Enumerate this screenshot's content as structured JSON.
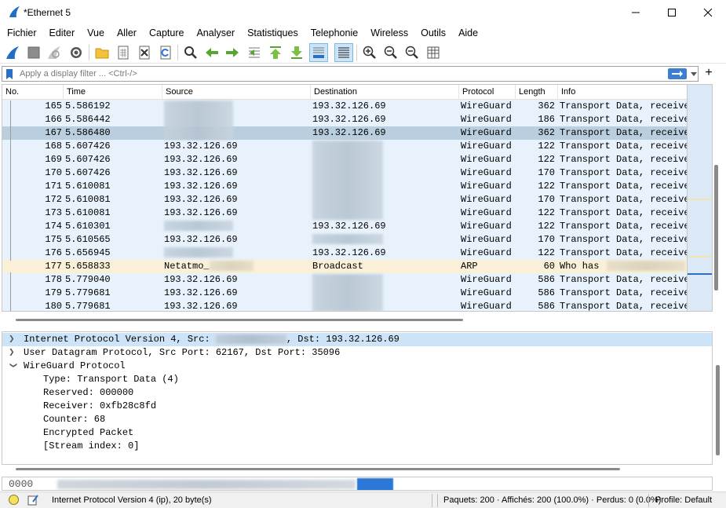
{
  "window": {
    "title": "*Ethernet 5"
  },
  "menu": [
    "Fichier",
    "Editer",
    "Vue",
    "Aller",
    "Capture",
    "Analyser",
    "Statistiques",
    "Telephonie",
    "Wireless",
    "Outils",
    "Aide"
  ],
  "filter": {
    "placeholder": "Apply a display filter ... <Ctrl-/>",
    "plus": "+"
  },
  "packet_list": {
    "columns": [
      "No.",
      "Time",
      "Source",
      "Destination",
      "Protocol",
      "Length",
      "Info"
    ],
    "rows": [
      {
        "no": "165",
        "time": "5.586192",
        "src": "",
        "dst": "193.32.126.69",
        "proto": "WireGuard",
        "len": "362",
        "info": "Transport Data, receive"
      },
      {
        "no": "166",
        "time": "5.586442",
        "src": "",
        "dst": "193.32.126.69",
        "proto": "WireGuard",
        "len": "186",
        "info": "Transport Data, receive"
      },
      {
        "no": "167",
        "time": "5.586480",
        "src": "",
        "dst": "193.32.126.69",
        "proto": "WireGuard",
        "len": "362",
        "info": "Transport Data, receive"
      },
      {
        "no": "168",
        "time": "5.607426",
        "src": "193.32.126.69",
        "dst": "",
        "proto": "WireGuard",
        "len": "122",
        "info": "Transport Data, receive"
      },
      {
        "no": "169",
        "time": "5.607426",
        "src": "193.32.126.69",
        "dst": "",
        "proto": "WireGuard",
        "len": "122",
        "info": "Transport Data, receive"
      },
      {
        "no": "170",
        "time": "5.607426",
        "src": "193.32.126.69",
        "dst": "",
        "proto": "WireGuard",
        "len": "170",
        "info": "Transport Data, receive"
      },
      {
        "no": "171",
        "time": "5.610081",
        "src": "193.32.126.69",
        "dst": "",
        "proto": "WireGuard",
        "len": "122",
        "info": "Transport Data, receive"
      },
      {
        "no": "172",
        "time": "5.610081",
        "src": "193.32.126.69",
        "dst": "",
        "proto": "WireGuard",
        "len": "170",
        "info": "Transport Data, receive"
      },
      {
        "no": "173",
        "time": "5.610081",
        "src": "193.32.126.69",
        "dst": "",
        "proto": "WireGuard",
        "len": "122",
        "info": "Transport Data, receive"
      },
      {
        "no": "174",
        "time": "5.610301",
        "src": "",
        "dst": "193.32.126.69",
        "proto": "WireGuard",
        "len": "122",
        "info": "Transport Data, receive"
      },
      {
        "no": "175",
        "time": "5.610565",
        "src": "193.32.126.69",
        "dst": "",
        "proto": "WireGuard",
        "len": "170",
        "info": "Transport Data, receive"
      },
      {
        "no": "176",
        "time": "5.656945",
        "src": "",
        "dst": "193.32.126.69",
        "proto": "WireGuard",
        "len": "122",
        "info": "Transport Data, receive"
      },
      {
        "no": "177",
        "time": "5.658833",
        "src": "Netatmo_",
        "dst": "Broadcast",
        "proto": "ARP",
        "len": "60",
        "info": "Who has"
      },
      {
        "no": "178",
        "time": "5.779040",
        "src": "193.32.126.69",
        "dst": "",
        "proto": "WireGuard",
        "len": "586",
        "info": "Transport Data, receive"
      },
      {
        "no": "179",
        "time": "5.779681",
        "src": "193.32.126.69",
        "dst": "",
        "proto": "WireGuard",
        "len": "586",
        "info": "Transport Data, receive"
      },
      {
        "no": "180",
        "time": "5.779681",
        "src": "193.32.126.69",
        "dst": "",
        "proto": "WireGuard",
        "len": "586",
        "info": "Transport Data, receive"
      }
    ]
  },
  "details": {
    "ip_prefix": "Internet Protocol Version 4, Src: ",
    "ip_suffix": ", Dst: 193.32.126.69",
    "udp": "User Datagram Protocol, Src Port: 62167, Dst Port: 35096",
    "wg": "WireGuard Protocol",
    "wg_fields": [
      "Type: Transport Data (4)",
      "Reserved: 000000",
      "Receiver: 0xfb28c8fd",
      "Counter: 68",
      "Encrypted Packet",
      "[Stream index: 0]"
    ]
  },
  "bytes": {
    "offset": "0000"
  },
  "status": {
    "field": "Internet Protocol Version 4 (ip), 20 byte(s)",
    "packets": "Paquets: 200 · Affichés: 200 (100.0%) · Perdus: 0 (0.0%)",
    "profile": "Profile: Default"
  }
}
